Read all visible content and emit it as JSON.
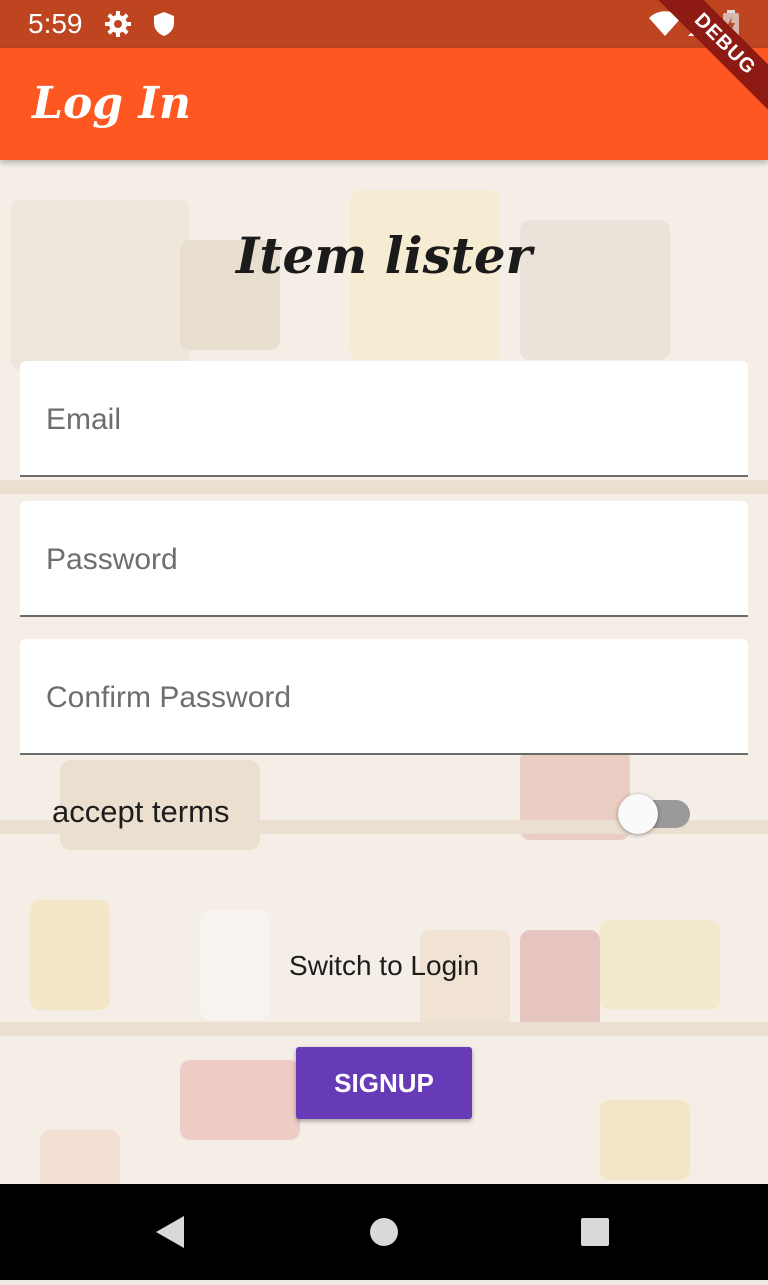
{
  "status_bar": {
    "time": "5:59",
    "icons": [
      "gear-icon",
      "shield-icon",
      "wifi-icon",
      "signal-icon",
      "battery-icon"
    ]
  },
  "app_bar": {
    "title": "Log In",
    "debug_banner": "DEBUG",
    "color": "#fe5722"
  },
  "main": {
    "heading": "Item lister",
    "fields": [
      {
        "placeholder": "Email",
        "value": ""
      },
      {
        "placeholder": "Password",
        "value": ""
      },
      {
        "placeholder": "Confirm Password",
        "value": ""
      }
    ],
    "terms_label": "accept terms",
    "terms_accepted": false,
    "switch_link": "Switch to Login",
    "signup_button": "SIGNUP",
    "button_color": "#673ab7"
  },
  "nav_bar": {
    "buttons": [
      "back-icon",
      "home-icon",
      "recents-icon"
    ]
  }
}
